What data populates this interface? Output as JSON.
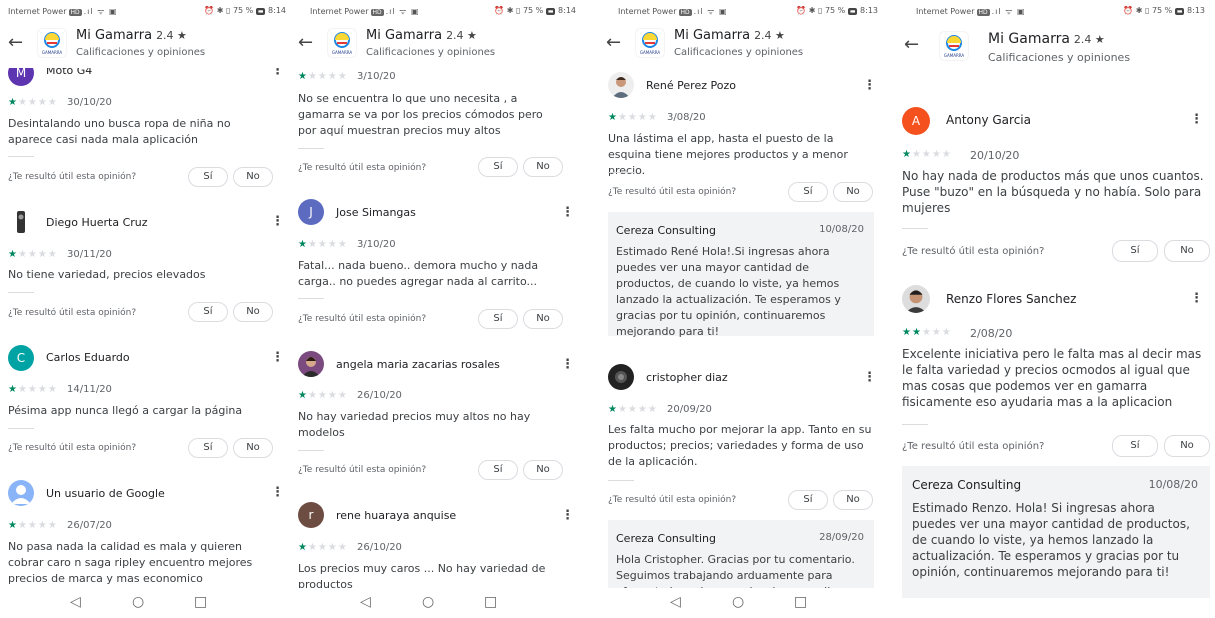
{
  "status_bar": {
    "carrier": "Internet Power",
    "hd": "HD",
    "battery": "75 %",
    "times": [
      "8:14",
      "8:14",
      "8:13",
      "8:13"
    ]
  },
  "app": {
    "name": "Mi Gamarra",
    "rating": "2.4 ★",
    "subtitle": "Calificaciones y opiniones",
    "logo_text": "GAMARRA"
  },
  "helpful": {
    "question": "¿Te resultó útil esta opinión?",
    "yes": "Sí",
    "no": "No"
  },
  "nav": {
    "back": "◁",
    "home": "○",
    "recent": "□"
  },
  "colors": {
    "star": "#01875f",
    "star_empty": "#dadce0",
    "accent_orange": "#f4511e",
    "accent_teal": "#00a3a3",
    "accent_purple": "#5e35b1",
    "accent_indigo": "#5c6bc0",
    "accent_brown": "#6d4c41"
  },
  "panels": [
    {
      "reviews": [
        {
          "name": "Moto G4",
          "avatar_letter": "M",
          "stars": 1,
          "date": "30/10/20",
          "text": "Desintalando uno busca ropa de niña no aparece casi nada mala aplicación"
        },
        {
          "name": "Diego Huerta Cruz",
          "avatar_letter": "",
          "stars": 1,
          "date": "30/11/20",
          "text": "No tiene variedad, precios elevados"
        },
        {
          "name": "Carlos Eduardo",
          "avatar_letter": "C",
          "stars": 1,
          "date": "14/11/20",
          "text": "Pésima app nunca llegó a cargar la página"
        },
        {
          "name": "Un usuario de Google",
          "avatar_letter": "",
          "stars": 1,
          "date": "26/07/20",
          "text": "No pasa nada la calidad es mala y quieren cobrar caro n saga ripley encuentro mejores precios de marca y mas economico"
        }
      ]
    },
    {
      "reviews": [
        {
          "name": "",
          "avatar_letter": "",
          "stars": 1,
          "date": "3/10/20",
          "text": "No se encuentra lo que uno necesita , a gamarra se va por los precios cómodos pero por aquí muestran precios muy altos"
        },
        {
          "name": "Jose Simangas",
          "avatar_letter": "J",
          "stars": 1,
          "date": "3/10/20",
          "text": "Fatal... nada bueno.. demora mucho y nada carga.. no puedes agregar nada al carrito..."
        },
        {
          "name": "angela maria zacarias rosales",
          "avatar_letter": "",
          "stars": 1,
          "date": "26/10/20",
          "text": "No hay variedad precios muy altos no hay modelos"
        },
        {
          "name": "rene huaraya anquise",
          "avatar_letter": "r",
          "stars": 1,
          "date": "26/10/20",
          "text": "Los precios muy caros ... No hay variedad de productos"
        }
      ]
    },
    {
      "reviews": [
        {
          "name": "René Perez Pozo",
          "avatar_letter": "",
          "stars": 1,
          "date": "3/08/20",
          "text": "Una lástima el app, hasta el puesto de la esquina tiene mejores productos y a menor precio.",
          "reply": {
            "dev": "Cereza Consulting",
            "date": "10/08/20",
            "text": "Estimado René Hola!.Si ingresas ahora puedes ver una mayor cantidad de productos, de cuando lo viste, ya hemos lanzado la actualización. Te esperamos y gracias por tu opinión, continuaremos mejorando para ti!"
          }
        },
        {
          "name": "cristopher diaz",
          "avatar_letter": "",
          "stars": 1,
          "date": "20/09/20",
          "text": "Les falta mucho por mejorar la app. Tanto en su productos; precios; variedades y forma de uso de la aplicación.",
          "reply": {
            "dev": "Cereza Consulting",
            "date": "28/09/20",
            "text": "Hola Cristopher. Gracias por tu comentario. Seguimos trabajando arduamente para ofrecerte la mejor experiencia y por ello"
          }
        }
      ]
    },
    {
      "reviews": [
        {
          "name": "Antony Garcia",
          "avatar_letter": "A",
          "stars": 1,
          "date": "20/10/20",
          "text": "No hay nada de productos más que unos cuantos. Puse \"buzo\" en la búsqueda y no había. Solo para mujeres"
        },
        {
          "name": "Renzo Flores Sanchez",
          "avatar_letter": "",
          "stars": 2,
          "date": "2/08/20",
          "text": "Excelente iniciativa pero le falta mas al decir mas le falta variedad y precios ocmodos al igual que mas cosas que podemos ver en gamarra fisicamente eso ayudaria mas a la aplicacion",
          "reply": {
            "dev": "Cereza Consulting",
            "date": "10/08/20",
            "text": "Estimado Renzo. Hola! Si ingresas ahora puedes ver una mayor cantidad de productos, de cuando lo viste, ya hemos lanzado la actualización. Te esperamos y gracias por tu opinión, continuaremos mejorando para ti!"
          }
        }
      ]
    }
  ]
}
